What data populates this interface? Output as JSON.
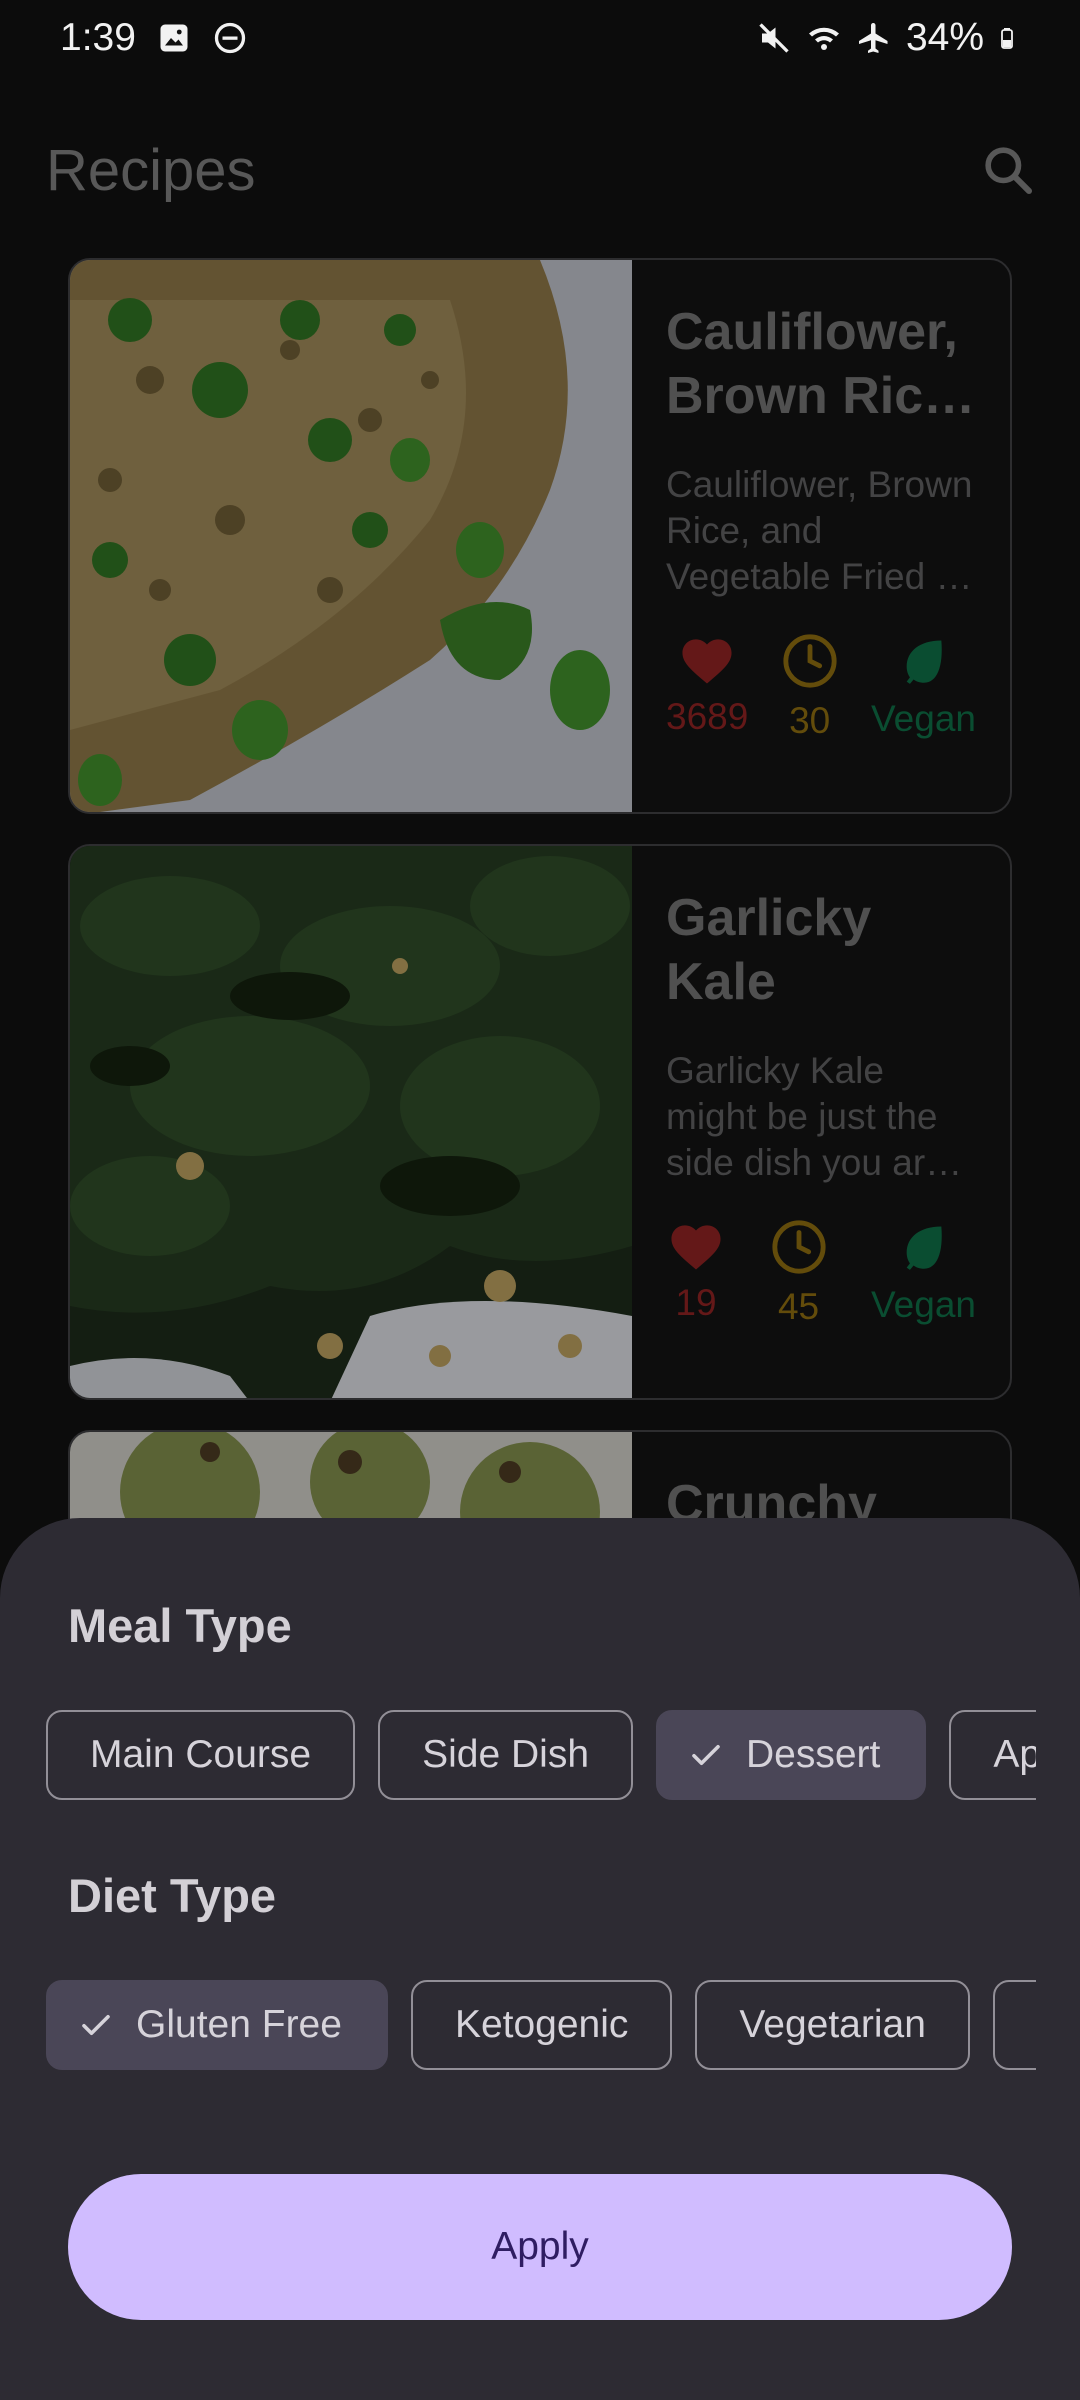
{
  "status_bar": {
    "time": "1:39",
    "battery": "34%",
    "icons": [
      "image-icon",
      "dnd-icon",
      "mute-icon",
      "wifi-icon",
      "airplane-icon",
      "battery-icon"
    ]
  },
  "app_bar": {
    "title": "Recipes",
    "search_icon": "search-icon"
  },
  "recipes": [
    {
      "title": "Cauliflower, Brown Ric…",
      "description": "Cauliflower, Brown Rice, and Vegetable Fried …",
      "likes": "3689",
      "minutes": "30",
      "diet": "Vegan"
    },
    {
      "title": "Garlicky Kale",
      "description": "Garlicky Kale might be just the side dish you ar…",
      "likes": "19",
      "minutes": "45",
      "diet": "Vegan"
    },
    {
      "title": "Crunchy",
      "description": "",
      "likes": "",
      "minutes": "",
      "diet": ""
    }
  ],
  "filter_sheet": {
    "meal_type": {
      "title": "Meal Type",
      "chips": [
        {
          "label": "Main Course",
          "selected": false
        },
        {
          "label": "Side Dish",
          "selected": false
        },
        {
          "label": "Dessert",
          "selected": true
        },
        {
          "label": "Ap",
          "selected": false
        }
      ]
    },
    "diet_type": {
      "title": "Diet Type",
      "chips": [
        {
          "label": "Gluten Free",
          "selected": true
        },
        {
          "label": "Ketogenic",
          "selected": false
        },
        {
          "label": "Vegetarian",
          "selected": false
        },
        {
          "label": "",
          "selected": false
        }
      ]
    },
    "apply_label": "Apply"
  },
  "colors": {
    "like": "#8b2222",
    "time": "#8a6a10",
    "vegan": "#0e6b45",
    "sheet_bg": "#2d2b33",
    "apply_bg": "#d0bcff",
    "selected_chip_bg": "#4a4657"
  }
}
